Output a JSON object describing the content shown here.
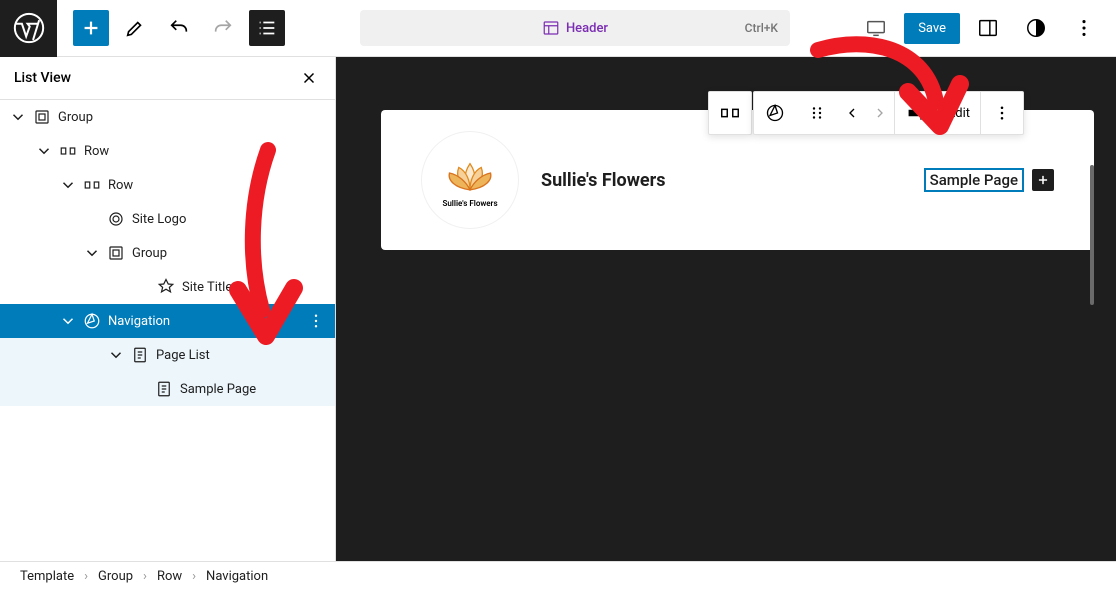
{
  "topbar": {
    "header_label": "Header",
    "shortcut": "Ctrl+K",
    "save": "Save"
  },
  "panel": {
    "title": "List View"
  },
  "tree": {
    "group": "Group",
    "row1": "Row",
    "row2": "Row",
    "site_logo": "Site Logo",
    "group2": "Group",
    "site_title": "Site Title",
    "navigation": "Navigation",
    "page_list": "Page List",
    "sample_page": "Sample Page"
  },
  "canvas": {
    "site_title": "Sullie's Flowers",
    "logo_caption": "Sullie's Flowers",
    "nav_item": "Sample Page",
    "toolbar_edit": "Edit"
  },
  "breadcrumb": {
    "a": "Template",
    "b": "Group",
    "c": "Row",
    "d": "Navigation"
  }
}
